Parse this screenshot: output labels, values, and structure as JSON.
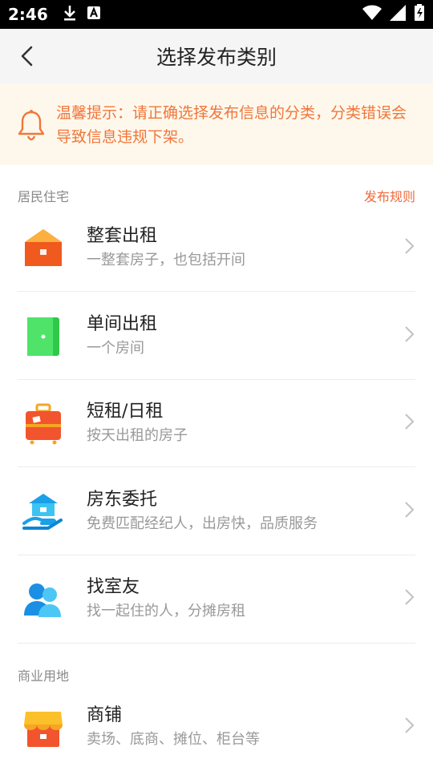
{
  "status_bar": {
    "time": "2:46"
  },
  "nav": {
    "title": "选择发布类别"
  },
  "notice": {
    "text": "温馨提示：请正确选择发布信息的分类，分类错误会导致信息违规下架。"
  },
  "sections": [
    {
      "label": "居民住宅",
      "rules_link": "发布规则",
      "items": [
        {
          "title": "整套出租",
          "subtitle": "一整套房子，也包括开间",
          "icon": "house-icon"
        },
        {
          "title": "单间出租",
          "subtitle": "一个房间",
          "icon": "door-icon"
        },
        {
          "title": "短租/日租",
          "subtitle": "按天出租的房子",
          "icon": "suitcase-icon"
        },
        {
          "title": "房东委托",
          "subtitle": "免费匹配经纪人，出房快，品质服务",
          "icon": "hand-house-icon"
        },
        {
          "title": "找室友",
          "subtitle": "找一起住的人，分摊房租",
          "icon": "people-icon"
        }
      ]
    },
    {
      "label": "商业用地",
      "items": [
        {
          "title": "商铺",
          "subtitle": "卖场、底商、摊位、柜台等",
          "icon": "shop-icon"
        }
      ]
    }
  ],
  "colors": {
    "accent": "#f06a3b",
    "notice_bg": "#fef8ec",
    "notice_text": "#f0763b"
  }
}
